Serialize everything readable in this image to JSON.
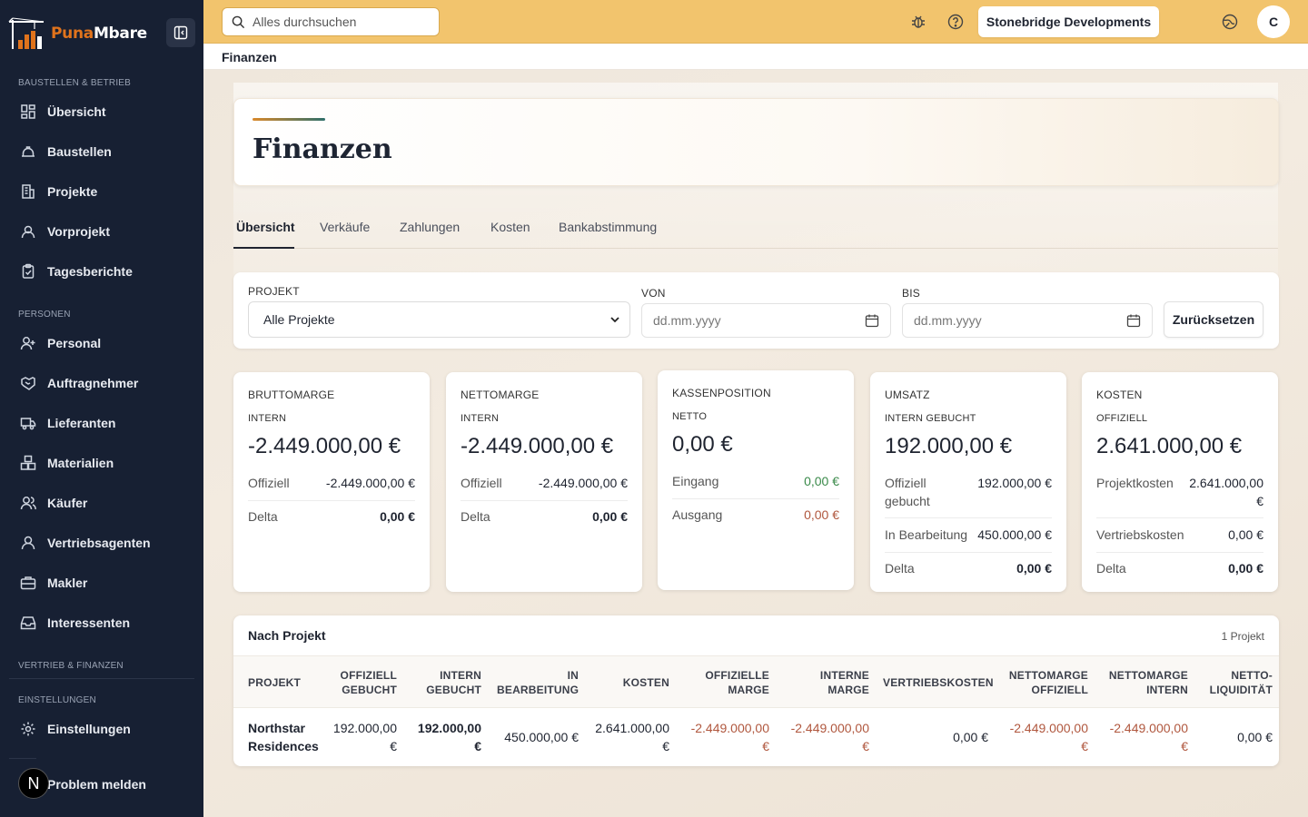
{
  "app": {
    "logo_part1": "Puna",
    "logo_part2": "Mbare"
  },
  "sidebar": {
    "sections": [
      {
        "label": "BAUSTELLEN & BETRIEB"
      },
      {
        "label": "PERSONEN"
      },
      {
        "label": "VERTRIEB & FINANZEN"
      },
      {
        "label": "EINSTELLUNGEN"
      }
    ],
    "items": [
      {
        "label": "Übersicht",
        "icon": "dashboard-icon"
      },
      {
        "label": "Baustellen",
        "icon": "hardhat-icon"
      },
      {
        "label": "Projekte",
        "icon": "building-icon"
      },
      {
        "label": "Vorprojekt",
        "icon": "user-search-icon"
      },
      {
        "label": "Tagesberichte",
        "icon": "clipboard-icon"
      },
      {
        "label": "Personal",
        "icon": "user-plus-icon"
      },
      {
        "label": "Auftragnehmer",
        "icon": "handshake-icon"
      },
      {
        "label": "Lieferanten",
        "icon": "truck-icon"
      },
      {
        "label": "Materialien",
        "icon": "boxes-icon"
      },
      {
        "label": "Käufer",
        "icon": "users-icon"
      },
      {
        "label": "Vertriebsagenten",
        "icon": "user-icon"
      },
      {
        "label": "Makler",
        "icon": "briefcase-icon"
      },
      {
        "label": "Interessenten",
        "icon": "inbox-icon"
      },
      {
        "label": "Einstellungen",
        "icon": "gear-icon"
      },
      {
        "label": "Problem melden",
        "icon": "flag-icon"
      }
    ],
    "avatar_letter": "N"
  },
  "topbar": {
    "search_placeholder": "Alles durchsuchen",
    "company": "Stonebridge Developments",
    "user_initial": "C"
  },
  "breadcrumb": "Finanzen",
  "page": {
    "title": "Finanzen",
    "tabs": [
      "Übersicht",
      "Verkäufe",
      "Zahlungen",
      "Kosten",
      "Bankabstimmung"
    ]
  },
  "filters": {
    "project_label": "PROJEKT",
    "project_value": "Alle Projekte",
    "from_label": "VON",
    "to_label": "BIS",
    "date_placeholder": "dd.mm.yyyy",
    "reset": "Zurücksetzen"
  },
  "kpis": {
    "brutto": {
      "title": "BRUTTOMARGE",
      "sub": "INTERN",
      "value": "-2.449.000,00 €",
      "r1_label": "Offiziell",
      "r1_value": "-2.449.000,00 €",
      "r2_label": "Delta",
      "r2_value": "0,00 €"
    },
    "netto": {
      "title": "NETTOMARGE",
      "sub": "INTERN",
      "value": "-2.449.000,00 €",
      "r1_label": "Offiziell",
      "r1_value": "-2.449.000,00 €",
      "r2_label": "Delta",
      "r2_value": "0,00 €"
    },
    "kasse": {
      "title": "KASSENPOSITION",
      "sub": "NETTO",
      "value": "0,00 €",
      "r1_label": "Eingang",
      "r1_value": "0,00 €",
      "r2_label": "Ausgang",
      "r2_value": "0,00 €"
    },
    "umsatz": {
      "title": "UMSATZ",
      "sub": "INTERN GEBUCHT",
      "value": "192.000,00 €",
      "r1_label": "Offiziell gebucht",
      "r1_value": "192.000,00 €",
      "r2_label": "In Bearbeitung",
      "r2_value": "450.000,00 €",
      "r3_label": "Delta",
      "r3_value": "0,00 €"
    },
    "kosten": {
      "title": "KOSTEN",
      "sub": "OFFIZIELL",
      "value": "2.641.000,00 €",
      "r1_label": "Projektkosten",
      "r1_value": "2.641.000,00 €",
      "r2_label": "Vertriebskosten",
      "r2_value": "0,00 €",
      "r3_label": "Delta",
      "r3_value": "0,00 €"
    }
  },
  "by_project": {
    "title": "Nach Projekt",
    "count": "1 Projekt",
    "columns": [
      "PROJEKT",
      "OFFIZIELL GEBUCHT",
      "INTERN GEBUCHT",
      "IN BEARBEITUNG",
      "KOSTEN",
      "OFFIZIELLE MARGE",
      "INTERNE MARGE",
      "VERTRIEBSKOSTEN",
      "NETTOMARGE OFFIZIELL",
      "NETTOMARGE INTERN",
      "NETTO-LIQUIDITÄT"
    ],
    "rows": [
      {
        "project": "Northstar Residences",
        "offiziell_gebucht": "192.000,00 €",
        "intern_gebucht": "192.000,00 €",
        "in_bearbeitung": "450.000,00 €",
        "kosten": "2.641.000,00 €",
        "offizielle_marge": "-2.449.000,00 €",
        "interne_marge": "-2.449.000,00 €",
        "vertriebskosten": "0,00 €",
        "nettomarge_offiziell": "-2.449.000,00 €",
        "nettomarge_intern": "-2.449.000,00 €",
        "netto_liquiditaet": "0,00 €"
      }
    ]
  },
  "colors": {
    "sidebar_bg": "#172033",
    "topbar_bg": "#f2c46d",
    "accent_orange": "#e0731c",
    "negative": "#b0573e",
    "positive": "#3a8a4a"
  }
}
